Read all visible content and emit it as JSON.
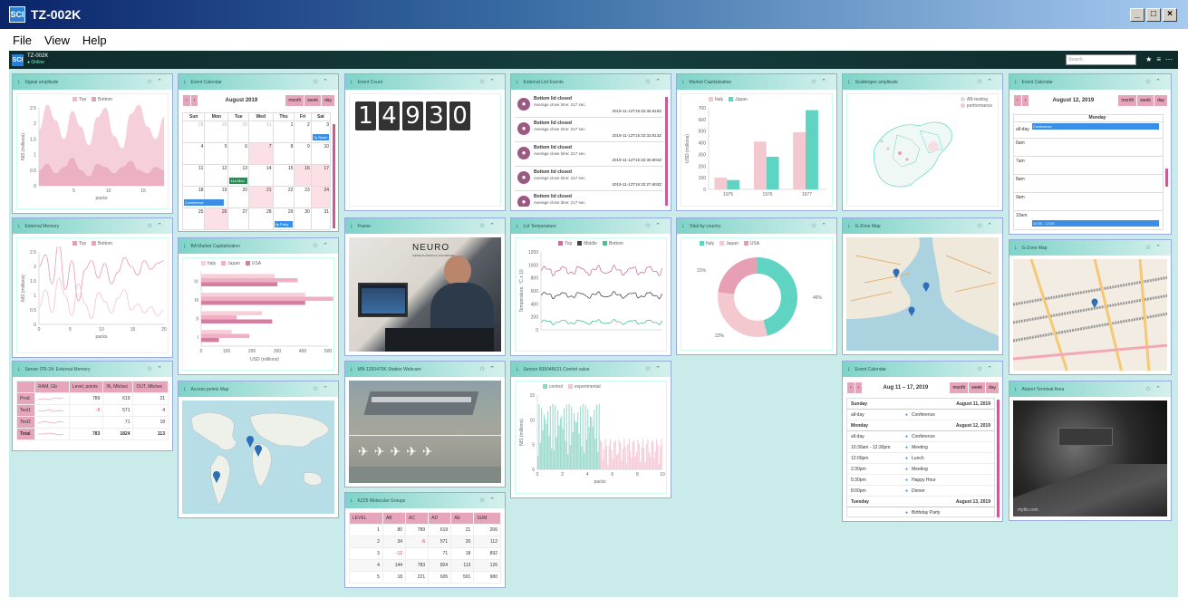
{
  "window": {
    "title": "TZ-002K",
    "logo": "SCI"
  },
  "menu": [
    "File",
    "View",
    "Help"
  ],
  "appbar": {
    "logo": "SCI",
    "title": "TZ-002K",
    "status": "Online",
    "search_placeholder": "Search"
  },
  "colors": {
    "pink": "#e7a5bc",
    "teal": "#5fd4c2",
    "header": "#7ed3c8",
    "bg": "#c9ebe9"
  },
  "panels": {
    "signal": {
      "title": "Signal amplitude",
      "legend": [
        "Top",
        "Bottom"
      ],
      "ylabel": "NIS (millions)",
      "xlabel": "packs",
      "xticks": [
        "5",
        "10",
        "15"
      ],
      "yticks": [
        "0",
        "0.5",
        "1",
        "1.5",
        "2",
        "2.5"
      ]
    },
    "event_cal1": {
      "title": "Event Calendar",
      "month": "August 2019",
      "views": [
        "month",
        "week",
        "day"
      ],
      "days": [
        "Sun",
        "Mon",
        "Tue",
        "Wed",
        "Thu",
        "Fri",
        "Sat"
      ],
      "weeks": [
        [
          "28",
          "29",
          "30",
          "31",
          "1",
          "2",
          "3"
        ],
        [
          "4",
          "5",
          "6",
          "7",
          "8",
          "9",
          "10"
        ],
        [
          "11",
          "12",
          "13",
          "14",
          "15",
          "16",
          "17"
        ],
        [
          "18",
          "19",
          "20",
          "21",
          "22",
          "23",
          "24"
        ],
        [
          "25",
          "26",
          "27",
          "28",
          "29",
          "30",
          "31"
        ]
      ],
      "events": {
        "business": "7p Busin",
        "mon": "11a Mon",
        "conference": "Conference",
        "party": "8p Party"
      }
    },
    "event_count": {
      "title": "Event Count",
      "digits": [
        "1",
        "4",
        "9",
        "3",
        "0"
      ]
    },
    "ext_list": {
      "title": "External List Events",
      "events": [
        {
          "title": "Bottom lid closed",
          "sub": "Average close time: 217 sec.",
          "time": "2019-11-12T15:32:36.819Z"
        },
        {
          "title": "Bottom lid closed",
          "sub": "Average close time: 217 sec.",
          "time": "2019-11-12T15:32:33.813Z"
        },
        {
          "title": "Bottom lid closed",
          "sub": "Average close time: 217 sec.",
          "time": "2019-11-12T15:32:30.804Z"
        },
        {
          "title": "Bottom lid closed",
          "sub": "Average close time: 217 sec.",
          "time": "2019-11-12T15:32:27.803Z"
        },
        {
          "title": "Bottom lid closed",
          "sub": "Average close time: 217 sec.",
          "time": ""
        }
      ]
    },
    "market_cap": {
      "title": "Market Capitalization",
      "legend": [
        "Italy",
        "Japan"
      ],
      "ylabel": "USD (millions)",
      "yticks": [
        "0",
        "100",
        "200",
        "300",
        "400",
        "500",
        "600",
        "700"
      ]
    },
    "scatter": {
      "title": "Scattergeo amplitude",
      "legend": [
        "AB-testing",
        "performance"
      ]
    },
    "event_cal2": {
      "title": "Event Calendar",
      "date": "August 12, 2019",
      "views": [
        "month",
        "week",
        "day"
      ],
      "day": "Monday",
      "allday": "all-day",
      "conference": "Conference",
      "hours": [
        "6am",
        "7am",
        "8am",
        "9am",
        "10am"
      ],
      "slot": "10:30 - 12:30"
    },
    "ext_mem": {
      "title": "External Memory",
      "legend": [
        "Top",
        "Bottom"
      ],
      "ylabel": "NIS (millions)",
      "xlabel": "packs",
      "xticks": [
        "0",
        "5",
        "10",
        "15",
        "20"
      ],
      "yticks": [
        "0",
        "0.5",
        "1",
        "1.5",
        "2",
        "2.5"
      ]
    },
    "ba_cap": {
      "title": "BA Market Capitalization",
      "legend": [
        "Italy",
        "Japan",
        "USA"
      ],
      "xlabel": "USD (millions)",
      "xticks": [
        "0",
        "100",
        "200",
        "300",
        "400",
        "500"
      ],
      "yticks": [
        "IV",
        "III",
        "II",
        "I"
      ]
    },
    "frame": {
      "title": "Frame",
      "brand_top": "NEURO",
      "brand_sub": "SIEMENS MEDICAL DASHBOARD"
    },
    "lot_temp": {
      "title": "Lot Temperature",
      "legend": [
        "Top",
        "Middle",
        "Bottom"
      ],
      "ylabel": "Temperature, °C x 10",
      "yticks": [
        "200",
        "400",
        "600",
        "800",
        "1000",
        "1200"
      ]
    },
    "by_country": {
      "title": "Total by country",
      "legend": [
        "Italy",
        "Japan",
        "USA"
      ],
      "labels": [
        "31%",
        "46%",
        "23%"
      ]
    },
    "gzone1": {
      "title": "G-Zone Map"
    },
    "gzone2": {
      "title": "G-Zone Map"
    },
    "server": {
      "title": "Server ITR-24: External Memory",
      "headers": [
        "",
        "RAM, Gb",
        "Level, points",
        "IN, Mb/sec",
        "OUT, Mb/sec"
      ],
      "rows": [
        [
          "Prod.",
          "",
          "789",
          "619",
          "21"
        ],
        [
          "Test1",
          "",
          "-6",
          "571",
          "4"
        ],
        [
          "Test2",
          "",
          "",
          "71",
          "18"
        ],
        [
          "Total",
          "",
          "783",
          "1824",
          "113"
        ]
      ]
    },
    "access": {
      "title": "Access points Map"
    },
    "webcam": {
      "title": "MN-1200470K Station Webcam"
    },
    "sensor": {
      "title": "Sensor 605045621 Control value",
      "legend": [
        "control",
        "experimental"
      ],
      "ylabel": "NIS (millions)",
      "xlabel": "packs",
      "xticks": [
        "0",
        "2",
        "4",
        "6",
        "8",
        "10"
      ],
      "yticks": [
        "0",
        "5",
        "10",
        "15"
      ]
    },
    "molecular": {
      "title": "KZ25 Molecular Groups",
      "headers": [
        "LEVEL",
        "AB",
        "AC",
        "AD",
        "AE",
        "SUM"
      ],
      "rows": [
        [
          "1",
          "80",
          "789",
          "619",
          "21",
          "206"
        ],
        [
          "2",
          "34",
          "-6",
          "571",
          "20",
          "112"
        ],
        [
          "3",
          "-12",
          "",
          "71",
          "18",
          "892"
        ],
        [
          "4",
          "144",
          "783",
          "824",
          "113",
          "126"
        ],
        [
          "5",
          "18",
          "221",
          "605",
          "501",
          "980"
        ]
      ]
    },
    "event_cal3": {
      "title": "Event Calendar",
      "date": "Aug 11 – 17, 2019",
      "views": [
        "month",
        "week",
        "day"
      ],
      "agenda": [
        {
          "type": "head",
          "left": "Sunday",
          "right": "August 11, 2019"
        },
        {
          "type": "row",
          "time": "all-day",
          "name": "Conference"
        },
        {
          "type": "head",
          "left": "Monday",
          "right": "August 12, 2019"
        },
        {
          "type": "row",
          "time": "all-day",
          "name": "Conference"
        },
        {
          "type": "row",
          "time": "10:30am - 12:30pm",
          "name": "Meeting"
        },
        {
          "type": "row",
          "time": "12:00pm",
          "name": "Lunch"
        },
        {
          "type": "row",
          "time": "2:30pm",
          "name": "Meeting"
        },
        {
          "type": "row",
          "time": "5:30pm",
          "name": "Happy Hour"
        },
        {
          "type": "row",
          "time": "8:00pm",
          "name": "Dinner"
        },
        {
          "type": "head",
          "left": "Tuesday",
          "right": "August 13, 2019"
        },
        {
          "type": "row",
          "time": "",
          "name": "Birthday Party"
        }
      ]
    },
    "gzone3": {
      "title": "G-Zone Map"
    },
    "airport": {
      "title": "Airport Terminal Area",
      "watermark": "mylto.com"
    }
  },
  "chart_data": [
    {
      "type": "area",
      "title": "Signal amplitude",
      "series": [
        {
          "name": "Top",
          "values": [
            1.8,
            2.6,
            2.1,
            1.5,
            2.4,
            1.9,
            1.3,
            2.2,
            2.5,
            1.6,
            1.2,
            2.3,
            2.6,
            1.9,
            1.5,
            2.2
          ]
        },
        {
          "name": "Bottom",
          "values": [
            0.5,
            0.7,
            0.4,
            0.6,
            0.9,
            0.5,
            0.3,
            0.7,
            0.6,
            0.4,
            0.6,
            0.8,
            0.5,
            0.4,
            0.6,
            0.5
          ]
        }
      ],
      "ylim": [
        0,
        2.5
      ]
    },
    {
      "type": "line",
      "title": "External Memory",
      "series": [
        {
          "name": "Top",
          "values": [
            2.0,
            2.4,
            1.4,
            2.8,
            1.2,
            2.2,
            0.8,
            1.9,
            2.2,
            1.6,
            2.1,
            1.4,
            1.8,
            2.3,
            2.0,
            1.7,
            2.2,
            1.9,
            2.1,
            2.2
          ]
        },
        {
          "name": "Bottom",
          "values": [
            0.6,
            1.2,
            0.4,
            1.6,
            1.0,
            0.3,
            1.4,
            0.7,
            0.2,
            1.1,
            0.8,
            0.4,
            0.9,
            1.2,
            0.5,
            0.7,
            0.4,
            0.6,
            0.3,
            0.5
          ]
        }
      ],
      "ylim": [
        0,
        2.5
      ]
    },
    {
      "type": "bar",
      "title": "Market Capitalization",
      "categories": [
        "1975",
        "1976",
        "1977"
      ],
      "series": [
        {
          "name": "Italy",
          "values": [
            100,
            410,
            490
          ]
        },
        {
          "name": "Japan",
          "values": [
            80,
            280,
            680
          ]
        }
      ],
      "ylim": [
        0,
        700
      ]
    },
    {
      "type": "bar",
      "title": "BA Market Capitalization",
      "categories": [
        "IV",
        "III",
        "II",
        "I"
      ],
      "series": [
        {
          "name": "Italy",
          "values": [
            290,
            410,
            240,
            120
          ]
        },
        {
          "name": "Japan",
          "values": [
            380,
            520,
            140,
            190
          ]
        },
        {
          "name": "USA",
          "values": [
            300,
            410,
            280,
            70
          ]
        }
      ],
      "xlim": [
        0,
        500
      ]
    },
    {
      "type": "pie",
      "title": "Total by country",
      "categories": [
        "Italy",
        "Japan",
        "USA"
      ],
      "values": [
        46,
        31,
        23
      ]
    }
  ]
}
